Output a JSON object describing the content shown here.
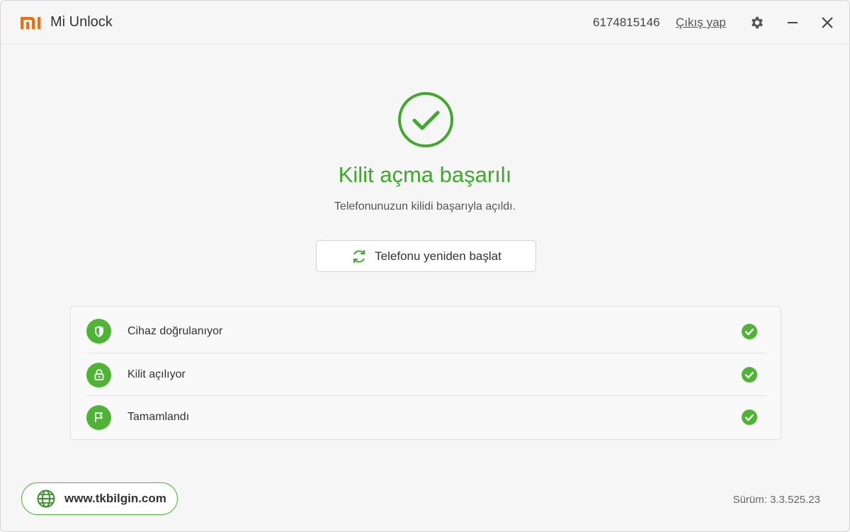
{
  "app": {
    "title": "Mi Unlock",
    "brand_color": "#ff6900",
    "account_id": "6174815146",
    "logout_label": "Çıkış yap"
  },
  "result": {
    "heading": "Kilit açma başarılı",
    "subheading": "Telefonunuzun kilidi başarıyla açıldı.",
    "accent_color": "#3faa2a",
    "restart_label": "Telefonu yeniden başlat"
  },
  "steps": [
    {
      "label": "Cihaz doğrulanıyor",
      "icon": "shield-icon",
      "status": "done"
    },
    {
      "label": "Kilit açılıyor",
      "icon": "lock-icon",
      "status": "done"
    },
    {
      "label": "Tamamlandı",
      "icon": "flag-icon",
      "status": "done"
    }
  ],
  "footer": {
    "website": "www.tkbilgin.com",
    "version": "Sürüm: 3.3.525.23"
  }
}
